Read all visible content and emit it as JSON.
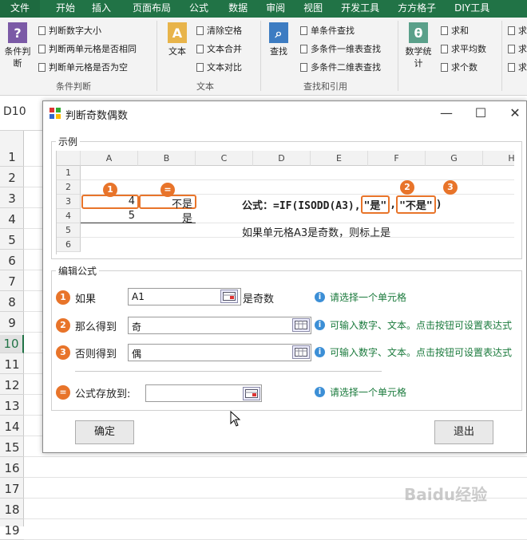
{
  "tabs": [
    "文件",
    "开始",
    "插入",
    "页面布局",
    "公式",
    "数据",
    "审阅",
    "视图",
    "开发工具",
    "方方格子",
    "DIY工具"
  ],
  "ribbon": {
    "cond_btn": "条件判\n断",
    "cond_items": [
      "判断数字大小",
      "判断两单元格是否相同",
      "判断单元格是否为空"
    ],
    "cond_group": "条件判断",
    "text_btn": "文本",
    "text_items": [
      "清除空格",
      "文本合并",
      "文本对比"
    ],
    "text_group": "文本",
    "find_btn": "查找",
    "find_items": [
      "单条件查找",
      "多条件一维表查找",
      "多条件二维表查找"
    ],
    "find_group": "查找和引用",
    "stat_btn": "数学统\n计",
    "stat_items": [
      "求和",
      "求平均数",
      "求个数"
    ],
    "stat_more": [
      "求",
      "求",
      "求"
    ]
  },
  "namebox": "D10",
  "rows": [
    "1",
    "2",
    "3",
    "4",
    "5",
    "6",
    "7",
    "8",
    "9",
    "10",
    "11",
    "12",
    "13",
    "14",
    "15",
    "16",
    "17",
    "18",
    "19"
  ],
  "dialog": {
    "title": "判断奇数偶数",
    "example_label": "示例",
    "cols": [
      "A",
      "B",
      "C",
      "D",
      "E",
      "F",
      "G",
      "H"
    ],
    "mini_rows": [
      "1",
      "2",
      "3",
      "4",
      "5",
      "6"
    ],
    "a3": "4",
    "b3": "不是",
    "a4": "5",
    "b4": "是",
    "formula_prefix": "公式：=IF(ISODD(A3),",
    "formula_yes": "\"是\"",
    "formula_comma": ",",
    "formula_no": "\"不是\"",
    "formula_suffix": ")",
    "explain": "如果单元格A3是奇数，则标上是",
    "badges": [
      "1",
      "=",
      "2",
      "3"
    ],
    "edit_label": "编辑公式",
    "if_label": "如果",
    "if_value": "A1",
    "if_suffix": "是奇数",
    "if_hint": "请选择一个单元格",
    "then_label": "那么得到",
    "then_value": "奇",
    "then_hint": "可输入数字、文本。点击按钮可设置表达式",
    "else_label": "否则得到",
    "else_value": "偶",
    "else_hint": "可输入数字、文本。点击按钮可设置表达式",
    "store_label": "公式存放到:",
    "store_value": "",
    "store_hint": "请选择一个单元格",
    "ok": "确定",
    "exit": "退出",
    "step_badges": [
      "1",
      "2",
      "3",
      "="
    ]
  },
  "watermark": "Baidu经验",
  "colors": {
    "excel_green": "#217346",
    "accent_orange": "#e8742a",
    "hint_green": "#1a7a3c"
  }
}
